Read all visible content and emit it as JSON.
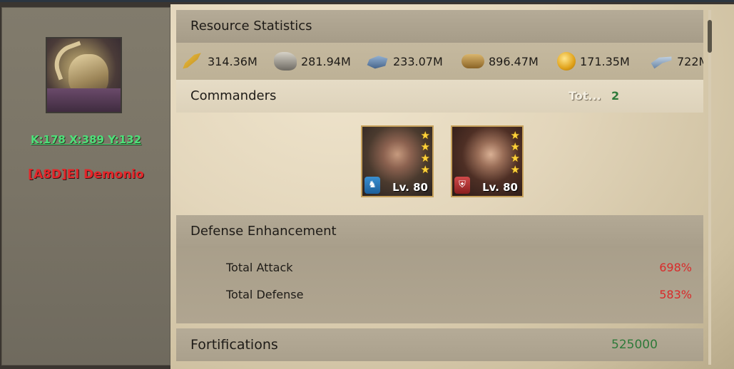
{
  "player": {
    "coordinates": "K:178 X:389 Y:132",
    "name": "[A8D]El Demonio"
  },
  "resources": {
    "title": "Resource Statistics",
    "items": [
      {
        "icon": "grain-icon",
        "value": "314.36M"
      },
      {
        "icon": "stone-icon",
        "value": "281.94M"
      },
      {
        "icon": "iron-icon",
        "value": "233.07M"
      },
      {
        "icon": "wood-icon",
        "value": "896.47M"
      },
      {
        "icon": "gold-icon",
        "value": "171.35M"
      },
      {
        "icon": "steel-icon",
        "value": "722M"
      }
    ]
  },
  "commanders": {
    "title": "Commanders",
    "total_label": "Tot...",
    "total_value": "2",
    "cards": [
      {
        "level": "Lv. 80",
        "stars": 4,
        "badge": "cavalry-icon"
      },
      {
        "level": "Lv. 80",
        "stars": 4,
        "badge": "shield-icon"
      }
    ]
  },
  "defense": {
    "title": "Defense Enhancement",
    "rows": [
      {
        "label": "Total Attack",
        "value": "698%"
      },
      {
        "label": "Total Defense",
        "value": "583%"
      }
    ]
  },
  "fortifications": {
    "title": "Fortifications",
    "value": "525000"
  },
  "colors": {
    "coords_green": "#4fe07a",
    "name_red": "#e3262a",
    "stat_red": "#d92a2a",
    "value_green": "#2e7a3a"
  }
}
